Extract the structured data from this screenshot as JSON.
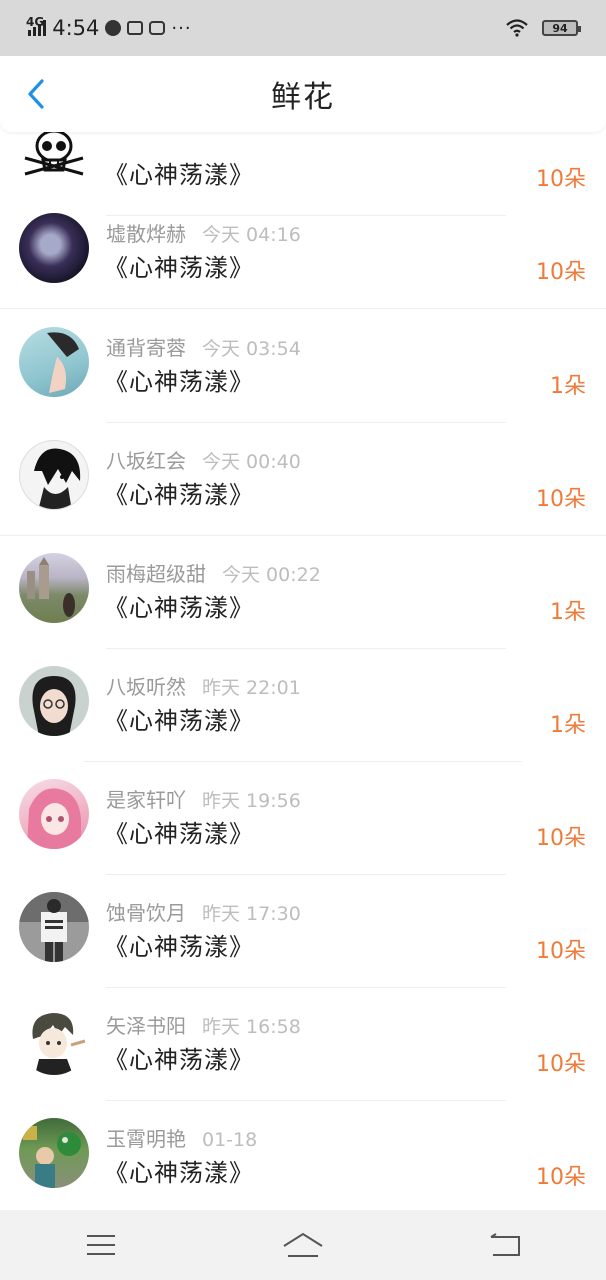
{
  "status_bar": {
    "network": "4G",
    "time": "4:54",
    "dots": "···",
    "battery": "94"
  },
  "header": {
    "title": "鲜花"
  },
  "records": [
    {
      "name": "",
      "time": "",
      "song": "《心神荡漾》",
      "flowers": "10朵",
      "avatar": "skull"
    },
    {
      "name": "墟散烨赫",
      "time": "今天 04:16",
      "song": "《心神荡漾》",
      "flowers": "10朵",
      "avatar": "dark"
    },
    {
      "name": "通背寄蓉",
      "time": "今天 03:54",
      "song": "《心神荡漾》",
      "flowers": "1朵",
      "avatar": "teal"
    },
    {
      "name": "八坂红会",
      "time": "今天 00:40",
      "song": "《心神荡漾》",
      "flowers": "10朵",
      "avatar": "manga"
    },
    {
      "name": "雨梅超级甜",
      "time": "今天 00:22",
      "song": "《心神荡漾》",
      "flowers": "1朵",
      "avatar": "castle"
    },
    {
      "name": "八坂听然",
      "time": "昨天 22:01",
      "song": "《心神荡漾》",
      "flowers": "1朵",
      "avatar": "girl"
    },
    {
      "name": "是家轩吖",
      "time": "昨天 19:56",
      "song": "《心神荡漾》",
      "flowers": "10朵",
      "avatar": "pink"
    },
    {
      "name": "蚀骨饮月",
      "time": "昨天 17:30",
      "song": "《心神荡漾》",
      "flowers": "10朵",
      "avatar": "street"
    },
    {
      "name": "矢泽书阳",
      "time": "昨天 16:58",
      "song": "《心神荡漾》",
      "flowers": "10朵",
      "avatar": "cartoon"
    },
    {
      "name": "玉霄明艳",
      "time": "01-18",
      "song": "《心神荡漾》",
      "flowers": "10朵",
      "avatar": "green"
    }
  ],
  "colors": {
    "accent": "#f07a38",
    "back_arrow": "#1e90e6",
    "status_bar_bg": "#d9d9d9",
    "nav_bg": "#f2f2f2"
  },
  "icons": {
    "back": "chevron-left-icon",
    "menu": "menu-icon",
    "home": "home-icon",
    "return": "return-icon"
  }
}
